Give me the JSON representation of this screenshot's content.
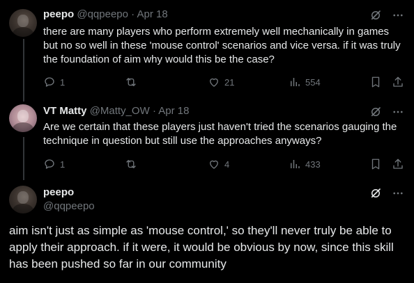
{
  "tweets": [
    {
      "name": "peepo",
      "handle": "@qqpeepo",
      "sep": "·",
      "date": "Apr 18",
      "text": "there are many players who perform extremely well mechanically in games but no so well in these 'mouse control' scenarios and vice versa. if it was truly the foundation of aim why would this be the case?",
      "replies": "1",
      "retweets": "",
      "likes": "21",
      "views": "554"
    },
    {
      "name": "VT Matty",
      "handle": "@Matty_OW",
      "sep": "·",
      "date": "Apr 18",
      "text": "Are we certain that these players just haven't tried the scenarios gauging the technique in question but still use the approaches anyways?",
      "replies": "1",
      "retweets": "",
      "likes": "4",
      "views": "433"
    }
  ],
  "main_tweet": {
    "name": "peepo",
    "handle": "@qqpeepo",
    "text": "aim isn't just as simple as 'mouse control,' so they'll never truly be able to apply their approach. if it were, it would be obvious by now, since this skill has been pushed so far in our community"
  },
  "colors": {
    "background": "#000000",
    "text": "#e7e9ea",
    "muted": "#71767b",
    "thread_line": "#333639"
  },
  "icons": [
    "grok-icon",
    "more-icon",
    "reply-icon",
    "retweet-icon",
    "like-icon",
    "views-icon",
    "bookmark-icon",
    "share-icon"
  ]
}
